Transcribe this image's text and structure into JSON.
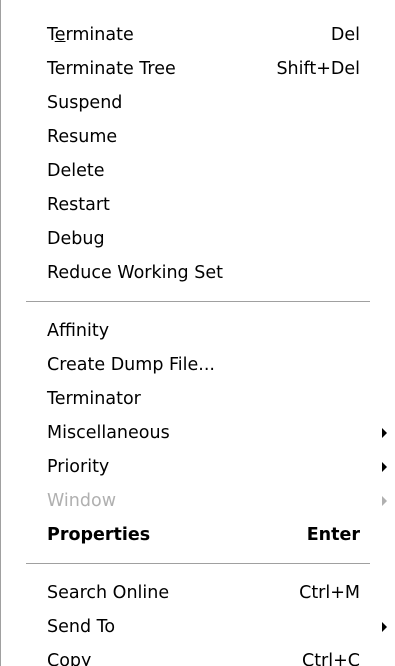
{
  "menu": {
    "group1": [
      {
        "label_pre": "T",
        "label_mn": "e",
        "label_post": "rminate",
        "shortcut": "Del"
      },
      {
        "label": "Terminate Tree",
        "shortcut": "Shift+Del"
      },
      {
        "label": "Suspend",
        "shortcut": ""
      },
      {
        "label": "Resume",
        "shortcut": ""
      },
      {
        "label": "Delete",
        "shortcut": ""
      },
      {
        "label": "Restart",
        "shortcut": ""
      },
      {
        "label": "Debug",
        "shortcut": ""
      },
      {
        "label": "Reduce Working Set",
        "shortcut": ""
      }
    ],
    "group2": [
      {
        "label": "Affinity",
        "shortcut": ""
      },
      {
        "label": "Create Dump File...",
        "shortcut": ""
      },
      {
        "label": "Terminator",
        "shortcut": ""
      },
      {
        "label": "Miscellaneous",
        "shortcut": "",
        "submenu": true
      },
      {
        "label": "Priority",
        "shortcut": "",
        "submenu": true
      },
      {
        "label": "Window",
        "shortcut": "",
        "submenu": true,
        "disabled": true
      },
      {
        "label": "Properties",
        "shortcut": "Enter",
        "default": true
      }
    ],
    "group3": [
      {
        "label": "Search Online",
        "shortcut": "Ctrl+M"
      },
      {
        "label": "Send To",
        "shortcut": "",
        "submenu": true
      },
      {
        "label": "Copy",
        "shortcut": "Ctrl+C"
      }
    ]
  },
  "icons": {
    "submenu_arrow": "submenu-arrow-icon"
  },
  "colors": {
    "disabled_text": "#b0b0b0",
    "separator": "#a0a0a0",
    "background": "#ffffff"
  }
}
